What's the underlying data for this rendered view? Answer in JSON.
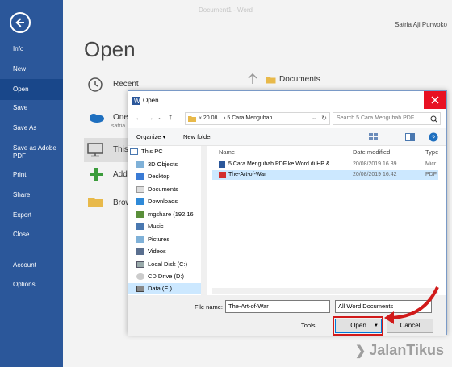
{
  "app": {
    "title": "Document1 - Word",
    "user": "Satria Aji Purwoko"
  },
  "sidebar": {
    "items": [
      {
        "label": "Info"
      },
      {
        "label": "New"
      },
      {
        "label": "Open"
      },
      {
        "label": "Save"
      },
      {
        "label": "Save As"
      },
      {
        "label": "Save as Adobe PDF"
      },
      {
        "label": "Print"
      },
      {
        "label": "Share"
      },
      {
        "label": "Export"
      },
      {
        "label": "Close"
      },
      {
        "label": "Account"
      },
      {
        "label": "Options"
      }
    ],
    "active_index": 2
  },
  "open_page": {
    "title": "Open",
    "locations": [
      {
        "label": "Recent",
        "icon": "clock-icon"
      },
      {
        "label": "One",
        "sub": "satria",
        "icon": "onedrive-icon"
      },
      {
        "label": "This",
        "icon": "pc-icon"
      },
      {
        "label": "Add",
        "icon": "plus-icon"
      },
      {
        "label": "Brow",
        "icon": "folder-icon"
      }
    ],
    "documents_label": "Documents"
  },
  "dialog": {
    "title": "Open",
    "address_path": "« 20.08... › 5 Cara Mengubah...",
    "search_placeholder": "Search 5 Cara Mengubah PDF...",
    "toolbar": {
      "organize": "Organize ▾",
      "new_folder": "New folder"
    },
    "nav": [
      {
        "label": "This PC",
        "icon": "pc-icon"
      },
      {
        "label": "3D Objects",
        "icon": "cube-icon"
      },
      {
        "label": "Desktop",
        "icon": "desktop-icon"
      },
      {
        "label": "Documents",
        "icon": "document-icon"
      },
      {
        "label": "Downloads",
        "icon": "download-icon"
      },
      {
        "label": "mgshare (192.16",
        "icon": "network-icon"
      },
      {
        "label": "Music",
        "icon": "music-icon"
      },
      {
        "label": "Pictures",
        "icon": "pictures-icon"
      },
      {
        "label": "Videos",
        "icon": "video-icon"
      },
      {
        "label": "Local Disk (C:)",
        "icon": "disk-icon"
      },
      {
        "label": "CD Drive (D:)",
        "icon": "cd-icon"
      },
      {
        "label": "Data (E:)",
        "icon": "disk-icon"
      }
    ],
    "nav_selected_index": 11,
    "columns": {
      "name": "Name",
      "date": "Date modified",
      "type": "Type"
    },
    "files": [
      {
        "name": "5 Cara Mengubah PDF ke Word di HP & ...",
        "date": "20/08/2019 16.39",
        "type": "Micr",
        "icon": "word-file-icon"
      },
      {
        "name": "The-Art-of-War",
        "date": "20/08/2019 16.42",
        "type": "PDF",
        "icon": "pdf-file-icon"
      }
    ],
    "selected_file_index": 1,
    "file_name_label": "File name:",
    "file_name_value": "The-Art-of-War",
    "file_type_value": "All Word Documents",
    "tools_label": "Tools",
    "open_label": "Open",
    "cancel_label": "Cancel"
  },
  "watermark": "JalanTikus",
  "colors": {
    "sidebar": "#2b579a",
    "highlight": "#d11a1a",
    "selection": "#cce8ff"
  }
}
